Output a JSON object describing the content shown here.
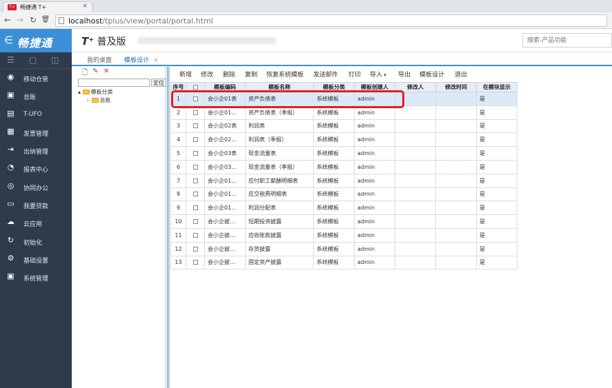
{
  "browser": {
    "tab_title": "畅捷通 T+",
    "tab_close": "×",
    "favicon_text": "T+",
    "url_host": "localhost",
    "url_path": "/tplus/view/portal/portal.html"
  },
  "app": {
    "brand": "畅捷通",
    "brand_arrow": "∈",
    "product_prefix": "T⁺",
    "product_name": "普及版",
    "search_placeholder": "搜索-产品功能"
  },
  "nav": {
    "items": [
      {
        "label": "移动仓管",
        "icon": "mobile-warehouse-icon",
        "glyph": "◉"
      },
      {
        "label": "总账",
        "icon": "ledger-icon",
        "glyph": "▣"
      },
      {
        "label": "T-UFO",
        "icon": "ufo-report-icon",
        "glyph": "▤"
      },
      {
        "label": "发票管理",
        "icon": "invoice-icon",
        "glyph": "▦"
      },
      {
        "label": "出纳管理",
        "icon": "cashier-icon",
        "glyph": "⇥"
      },
      {
        "label": "报表中心",
        "icon": "report-center-icon",
        "glyph": "◔"
      },
      {
        "label": "协同办公",
        "icon": "collaboration-icon",
        "glyph": "◎"
      },
      {
        "label": "我要贷款",
        "icon": "loan-icon",
        "glyph": "▭"
      },
      {
        "label": "云应用",
        "icon": "cloud-icon",
        "glyph": "☁"
      },
      {
        "label": "初始化",
        "icon": "initialize-icon",
        "glyph": "↻"
      },
      {
        "label": "基础设置",
        "icon": "settings-icon",
        "glyph": "⚙"
      },
      {
        "label": "系统管理",
        "icon": "system-icon",
        "glyph": "▣"
      }
    ]
  },
  "tabs": {
    "desktop": "我的桌面",
    "template_design": "模板设计",
    "close": "×"
  },
  "tree": {
    "locate_label": "定位",
    "root": "模板分类",
    "child": "总账"
  },
  "toolbar": {
    "add": "新增",
    "edit": "修改",
    "delete": "删除",
    "copy": "复制",
    "restore": "恢复系统模板",
    "send_mail": "发送邮件",
    "print": "打印",
    "import": "导入",
    "export": "导出",
    "template_design": "模板设计",
    "exit": "退出"
  },
  "grid": {
    "headers": [
      "序号",
      "",
      "模板编码",
      "模板名称",
      "模板分类",
      "模板创建人",
      "修改人",
      "修改时间",
      "在模块显示"
    ],
    "rows": [
      [
        "1",
        "会小企01表",
        "资产负债表",
        "系统模板",
        "admin",
        "",
        "",
        "是"
      ],
      [
        "2",
        "会小企01...",
        "资产负债表（季报）",
        "系统模板",
        "admin",
        "",
        "",
        "是"
      ],
      [
        "3",
        "会小企02表",
        "利润表",
        "系统模板",
        "admin",
        "",
        "",
        "是"
      ],
      [
        "4",
        "会小企02...",
        "利润表（季报）",
        "系统模板",
        "admin",
        "",
        "",
        "是"
      ],
      [
        "5",
        "会小企03表",
        "现金流量表",
        "系统模板",
        "admin",
        "",
        "",
        "是"
      ],
      [
        "6",
        "会小企03...",
        "现金流量表（季报）",
        "系统模板",
        "admin",
        "",
        "",
        "是"
      ],
      [
        "7",
        "会小企01...",
        "应付职工薪酬明细表",
        "系统模板",
        "admin",
        "",
        "",
        "是"
      ],
      [
        "8",
        "会小企01...",
        "应交税费明细表",
        "系统模板",
        "admin",
        "",
        "",
        "是"
      ],
      [
        "9",
        "会小企01...",
        "利润分配表",
        "系统模板",
        "admin",
        "",
        "",
        "是"
      ],
      [
        "10",
        "会小企披...",
        "短期投资披露",
        "系统模板",
        "admin",
        "",
        "",
        "是"
      ],
      [
        "11",
        "会小企披...",
        "应收账款披露",
        "系统模板",
        "admin",
        "",
        "",
        "是"
      ],
      [
        "12",
        "会小企披...",
        "存货披露",
        "系统模板",
        "admin",
        "",
        "",
        "是"
      ],
      [
        "13",
        "会小企披...",
        "固定资产披露",
        "系统模板",
        "admin",
        "",
        "",
        "是"
      ]
    ]
  }
}
